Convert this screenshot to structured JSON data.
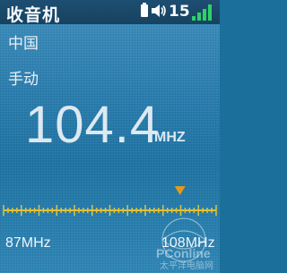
{
  "header": {
    "title": "收音机",
    "volume": "15",
    "icons": [
      "battery-icon",
      "volume-icon",
      "signal-icon"
    ]
  },
  "radio": {
    "region": "中国",
    "mode": "手动",
    "frequency": "104.4",
    "unit": "MHZ",
    "range_min": "87MHz",
    "range_max": "108MHz",
    "tuning_position": 0.83
  },
  "watermark": {
    "brand": "PConline",
    "caption": "太平洋电脑网"
  },
  "colors": {
    "title_bar": "#1b4a6b",
    "screen": "#2a7dae",
    "scale": "#e1c23a",
    "marker": "#e39a1e"
  }
}
